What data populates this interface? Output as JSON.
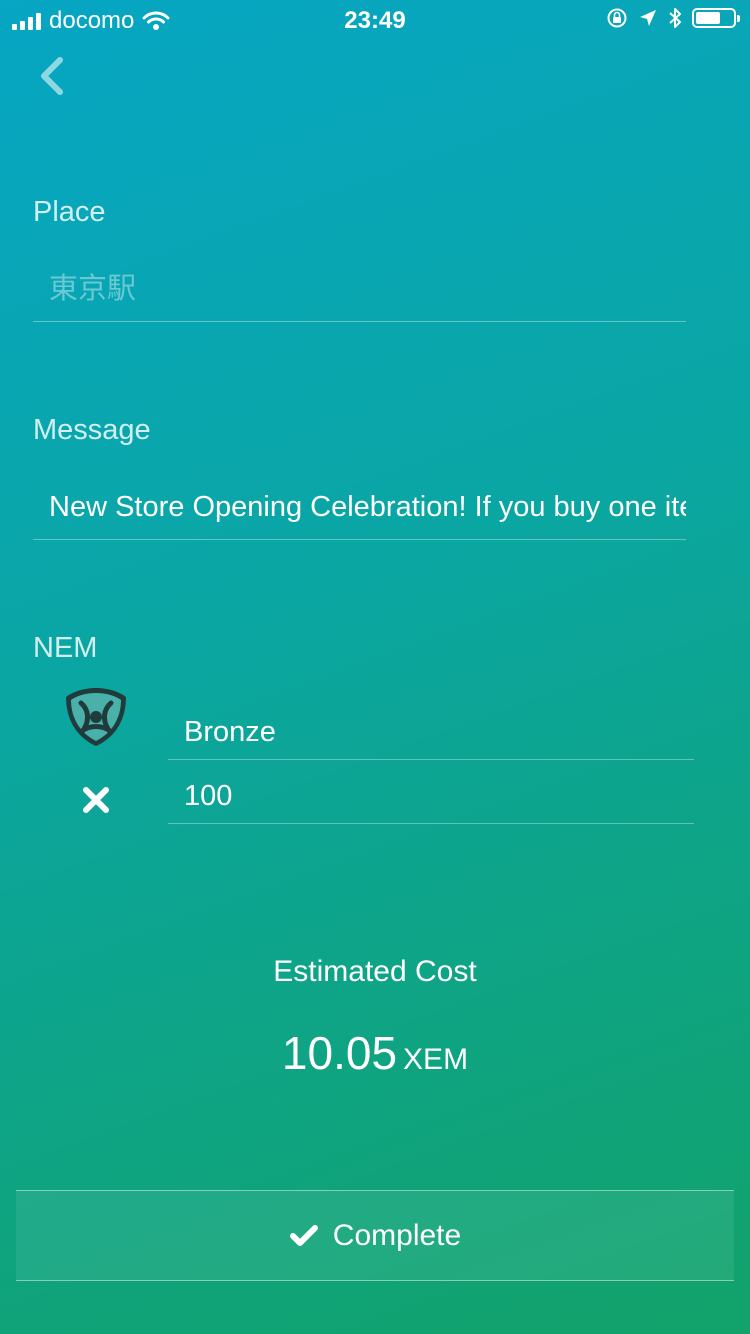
{
  "status_bar": {
    "carrier": "docomo",
    "time": "23:49"
  },
  "form": {
    "place": {
      "label": "Place",
      "placeholder": "東京駅"
    },
    "message": {
      "label": "Message",
      "value": "New Store Opening Celebration! If you buy one item"
    },
    "nem": {
      "label": "NEM",
      "mosaic": "Bronze",
      "quantity": "100"
    }
  },
  "estimate": {
    "label": "Estimated Cost",
    "value": "10.05",
    "unit": "XEM"
  },
  "complete_button": {
    "label": "Complete"
  },
  "icons": {
    "back": "chevron-left-icon",
    "nem_logo": "nem-logo-icon",
    "multiply": "multiply-icon",
    "check": "check-icon"
  },
  "colors": {
    "gradient_top": "#06a6c4",
    "gradient_bottom": "#12a26a"
  }
}
